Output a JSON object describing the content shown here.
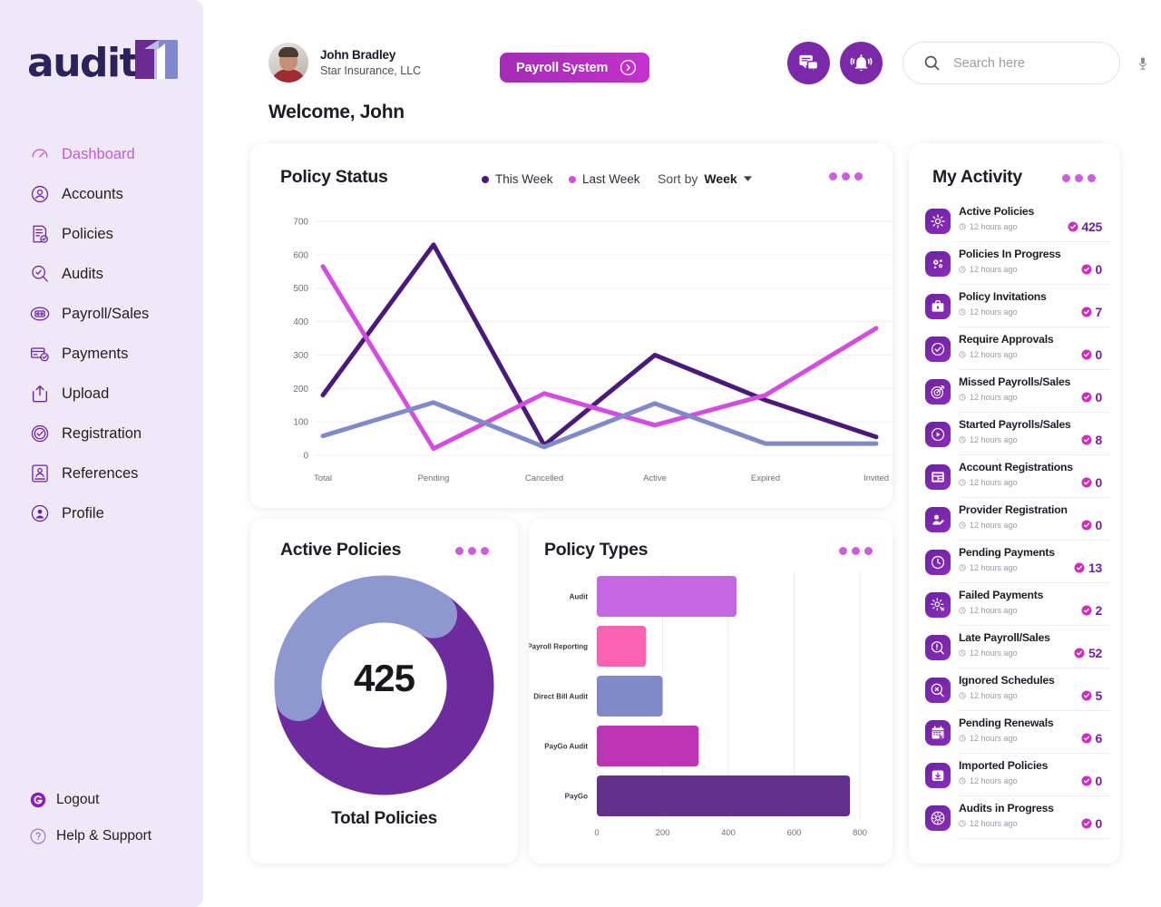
{
  "brand": {
    "logo_text": "audit",
    "logo_mark": "audit1-logo-icon"
  },
  "sidebar": {
    "items": [
      {
        "label": "Dashboard",
        "icon": "dashboard-icon",
        "active": true
      },
      {
        "label": "Accounts",
        "icon": "accounts-icon",
        "active": false
      },
      {
        "label": "Policies",
        "icon": "policies-icon",
        "active": false
      },
      {
        "label": "Audits",
        "icon": "audits-icon",
        "active": false
      },
      {
        "label": "Payroll/Sales",
        "icon": "payroll-sales-icon",
        "active": false
      },
      {
        "label": "Payments",
        "icon": "payments-icon",
        "active": false
      },
      {
        "label": "Upload",
        "icon": "upload-icon",
        "active": false
      },
      {
        "label": "Registration",
        "icon": "registration-icon",
        "active": false
      },
      {
        "label": "References",
        "icon": "references-icon",
        "active": false
      },
      {
        "label": "Profile",
        "icon": "profile-icon",
        "active": false
      }
    ],
    "bottom_items": [
      {
        "label": "Logout",
        "icon": "logout-icon"
      },
      {
        "label": "Help & Support",
        "icon": "help-icon"
      }
    ]
  },
  "header": {
    "user_name": "John Bradley",
    "user_org": "Star Insurance, LLC",
    "payroll_button": "Payroll System",
    "payroll_button_icon": "arrow-right-circle-icon",
    "chat_icon": "chat-icon",
    "bell_icon": "bell-icon",
    "search": {
      "placeholder": "Search here",
      "value": "",
      "icon": "search-icon",
      "mic_icon": "microphone-icon"
    },
    "welcome": "Welcome, John"
  },
  "policy_status": {
    "title": "Policy Status",
    "legend": [
      {
        "label": "This Week",
        "color": "#4a1a7a"
      },
      {
        "label": "Last Week",
        "color": "#d34de0"
      }
    ],
    "sort_prefix": "Sort by",
    "sort_value": "Week",
    "menu_icon": "more-options-icon"
  },
  "active_policies": {
    "title": "Active Policies",
    "value": "425",
    "caption": "Total Policies",
    "menu_icon": "more-options-icon"
  },
  "policy_types": {
    "title": "Policy Types",
    "menu_icon": "more-options-icon"
  },
  "activity": {
    "title": "My Activity",
    "menu_icon": "more-options-icon",
    "check_icon": "check-circle-icon",
    "clock_icon": "clock-icon",
    "items": [
      {
        "label": "Active Policies",
        "time": "12 hours ago",
        "count": "425",
        "icon": "gear-icon"
      },
      {
        "label": "Policies In Progress",
        "time": "12 hours ago",
        "count": "0",
        "icon": "gears-icon"
      },
      {
        "label": "Policy Invitations",
        "time": "12 hours ago",
        "count": "7",
        "icon": "briefcase-icon"
      },
      {
        "label": "Require Approvals",
        "time": "12 hours ago",
        "count": "0",
        "icon": "check-circle-icon"
      },
      {
        "label": "Missed Payrolls/Sales",
        "time": "12 hours ago",
        "count": "0",
        "icon": "target-icon"
      },
      {
        "label": "Started Payrolls/Sales",
        "time": "12 hours ago",
        "count": "8",
        "icon": "play-circle-icon"
      },
      {
        "label": "Account Registrations",
        "time": "12 hours ago",
        "count": "0",
        "icon": "card-register-icon"
      },
      {
        "label": "Provider Registration",
        "time": "12 hours ago",
        "count": "0",
        "icon": "user-edit-icon"
      },
      {
        "label": "Pending Payments",
        "time": "12 hours ago",
        "count": "13",
        "icon": "clock-circle-icon"
      },
      {
        "label": "Failed Payments",
        "time": "12 hours ago",
        "count": "2",
        "icon": "gear-error-icon"
      },
      {
        "label": "Late Payroll/Sales",
        "time": "12 hours ago",
        "count": "52",
        "icon": "warning-circle-icon"
      },
      {
        "label": "Ignored Schedules",
        "time": "12 hours ago",
        "count": "5",
        "icon": "cancel-circle-icon"
      },
      {
        "label": "Pending Renewals",
        "time": "12 hours ago",
        "count": "6",
        "icon": "calendar-x-icon"
      },
      {
        "label": "Imported Policies",
        "time": "12 hours ago",
        "count": "0",
        "icon": "download-icon"
      },
      {
        "label": "Audits in Progress",
        "time": "12 hours ago",
        "count": "0",
        "icon": "settings-circle-icon"
      }
    ]
  },
  "chart_data": [
    {
      "id": "policy-status-line",
      "type": "line",
      "title": "Policy Status",
      "categories": [
        "Total",
        "Pending",
        "Cancelled",
        "Active",
        "Expired",
        "Invited"
      ],
      "series": [
        {
          "name": "This Week",
          "color": "#4a1a7a",
          "values": [
            180,
            630,
            30,
            300,
            165,
            55
          ]
        },
        {
          "name": "Last Week",
          "color": "#d34de0",
          "values": [
            565,
            20,
            185,
            90,
            180,
            380
          ]
        },
        {
          "name": "",
          "color": "#8189c9",
          "values": [
            58,
            158,
            25,
            155,
            35,
            35
          ]
        }
      ],
      "xlabel": "",
      "ylabel": "",
      "ylim": [
        0,
        700
      ],
      "yticks": [
        0,
        100,
        200,
        300,
        400,
        500,
        600,
        700
      ],
      "grid": true,
      "legend_position": "top"
    },
    {
      "id": "active-policies-donut",
      "type": "pie",
      "title": "Active Policies",
      "center_value": "425",
      "caption": "Total Policies",
      "slices": [
        {
          "name": "Active",
          "value": 63,
          "color": "#6d2b9e"
        },
        {
          "name": "Inactive",
          "value": 37,
          "color": "#8e97d0"
        }
      ]
    },
    {
      "id": "policy-types-bar",
      "type": "bar",
      "title": "Policy Types",
      "orientation": "horizontal",
      "categories": [
        "Audit",
        "Payroll Reporting",
        "Direct Bill Audit",
        "PayGo Audit",
        "PayGo"
      ],
      "values": [
        425,
        150,
        200,
        310,
        770
      ],
      "colors": [
        "#c467e0",
        "#fb62b4",
        "#8189c9",
        "#bc35b5",
        "#63308d"
      ],
      "xlim": [
        0,
        800
      ],
      "xticks": [
        0,
        200,
        400,
        600,
        800
      ],
      "grid": true
    }
  ]
}
